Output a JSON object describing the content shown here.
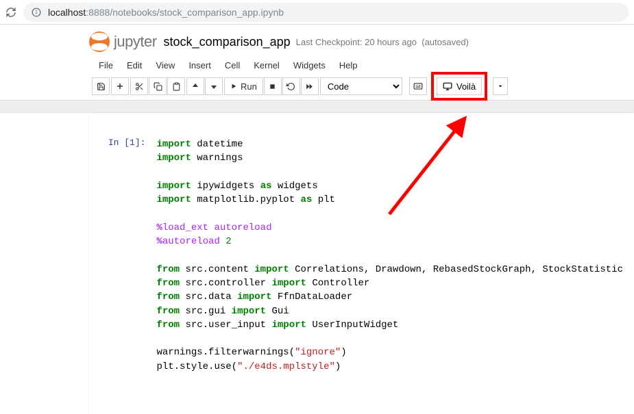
{
  "browser": {
    "url_host": "localhost",
    "url_port": ":8888",
    "url_path": "/notebooks/stock_comparison_app.ipynb"
  },
  "header": {
    "logo_text": "jupyter",
    "notebook_title": "stock_comparison_app",
    "checkpoint": "Last Checkpoint: 20 hours ago",
    "autosaved": "(autosaved)"
  },
  "menu": {
    "file": "File",
    "edit": "Edit",
    "view": "View",
    "insert": "Insert",
    "cell": "Cell",
    "kernel": "Kernel",
    "widgets": "Widgets",
    "help": "Help"
  },
  "toolbar": {
    "run_label": "Run",
    "cell_type": "Code",
    "voila_label": "Voilà"
  },
  "cell1": {
    "prompt": "In [1]:",
    "kw_import": "import",
    "kw_from": "from",
    "kw_as": "as",
    "mod_datetime": "datetime",
    "mod_warnings": "warnings",
    "mod_ipywidgets": "ipywidgets",
    "alias_widgets": "widgets",
    "mod_mpl": "matplotlib.pyplot",
    "alias_plt": "plt",
    "magic_pct": "%",
    "magic_loadext": "load_ext autoreload",
    "magic_autoreload": "autoreload ",
    "magic_autoreload_num": "2",
    "mod_content": "src.content",
    "imp_content": "Correlations, Drawdown, RebasedStockGraph, StockStatistic",
    "mod_controller": "src.controller",
    "imp_controller": "Controller",
    "mod_data": "src.data",
    "imp_data": "FfnDataLoader",
    "mod_gui": "src.gui",
    "imp_gui": "Gui",
    "mod_userinput": "src.user_input",
    "imp_userinput": "UserInputWidget",
    "line_filterwarnings_a": "warnings.filterwarnings(",
    "str_ignore": "\"ignore\"",
    "line_filterwarnings_b": ")",
    "line_style_a": "plt.style.use(",
    "str_style": "\"./e4ds.mplstyle\"",
    "line_style_b": ")"
  }
}
